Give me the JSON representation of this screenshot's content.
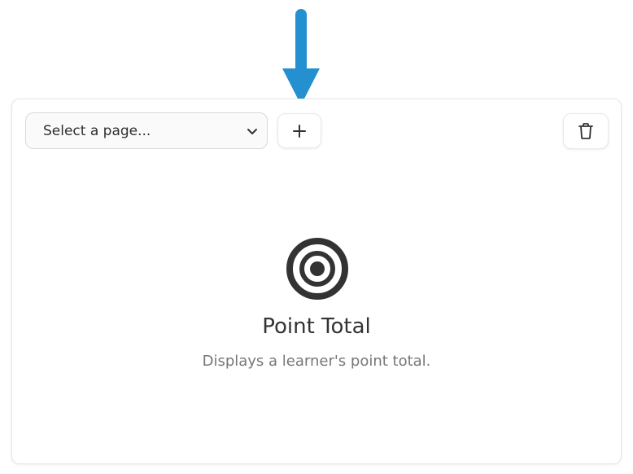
{
  "toolbar": {
    "page_select_placeholder": "Select a page...",
    "add_icon": "plus-icon",
    "delete_icon": "trash-icon"
  },
  "widget": {
    "icon": "target-icon",
    "title": "Point Total",
    "description": "Displays a learner's point total."
  },
  "annotation": {
    "arrow_color": "#2490d0",
    "arrow_direction": "down"
  }
}
